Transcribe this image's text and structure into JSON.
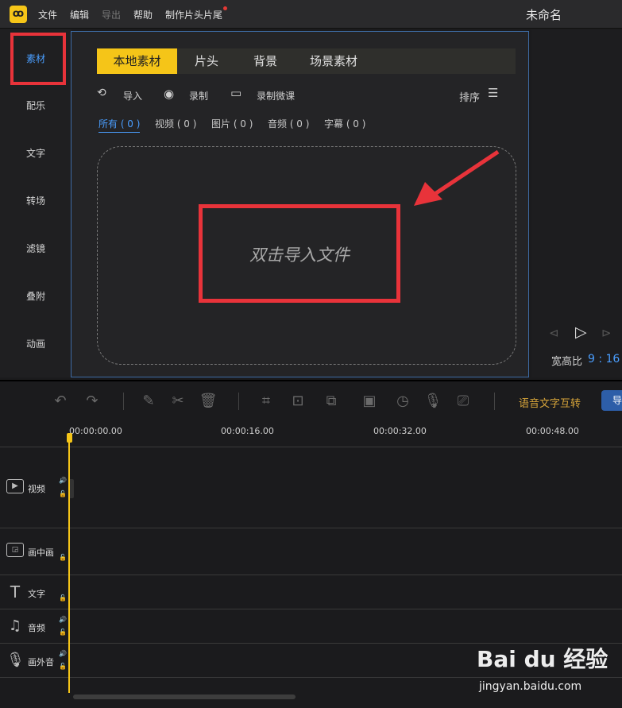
{
  "menu": {
    "items": [
      "文件",
      "编辑",
      "导出",
      "帮助",
      "制作片头片尾"
    ],
    "title": "未命名"
  },
  "sidebar": {
    "tabs": [
      "素材",
      "配乐",
      "文字",
      "转场",
      "滤镜",
      "叠附",
      "动画"
    ]
  },
  "library": {
    "tabs": [
      "本地素材",
      "片头",
      "背景",
      "场景素材"
    ],
    "tools": {
      "import": "导入",
      "record": "录制",
      "record_lesson": "录制微课",
      "sort": "排序"
    },
    "filters": [
      "所有 ( 0 )",
      "视频 ( 0 )",
      "图片 ( 0 )",
      "音频 ( 0 )",
      "字幕 ( 0 )"
    ],
    "drop_text": "双击导入文件"
  },
  "preview": {
    "ratio_label": "宽高比",
    "ratio_value": "9 : 16"
  },
  "toolbar": {
    "voice_text": "语音文字互转",
    "export_label": "导"
  },
  "timeline": {
    "ticks": [
      "00:00:00.00",
      "00:00:16.00",
      "00:00:32.00",
      "00:00:48.00"
    ],
    "tracks": [
      "视频",
      "画中画",
      "文字",
      "音频",
      "画外音"
    ]
  },
  "watermark": {
    "brand": "Bai du 经验",
    "url": "jingyan.baidu.com"
  },
  "colors": {
    "accent_yellow": "#f5c518",
    "accent_blue": "#4a9eff",
    "highlight_red": "#e8333a"
  }
}
